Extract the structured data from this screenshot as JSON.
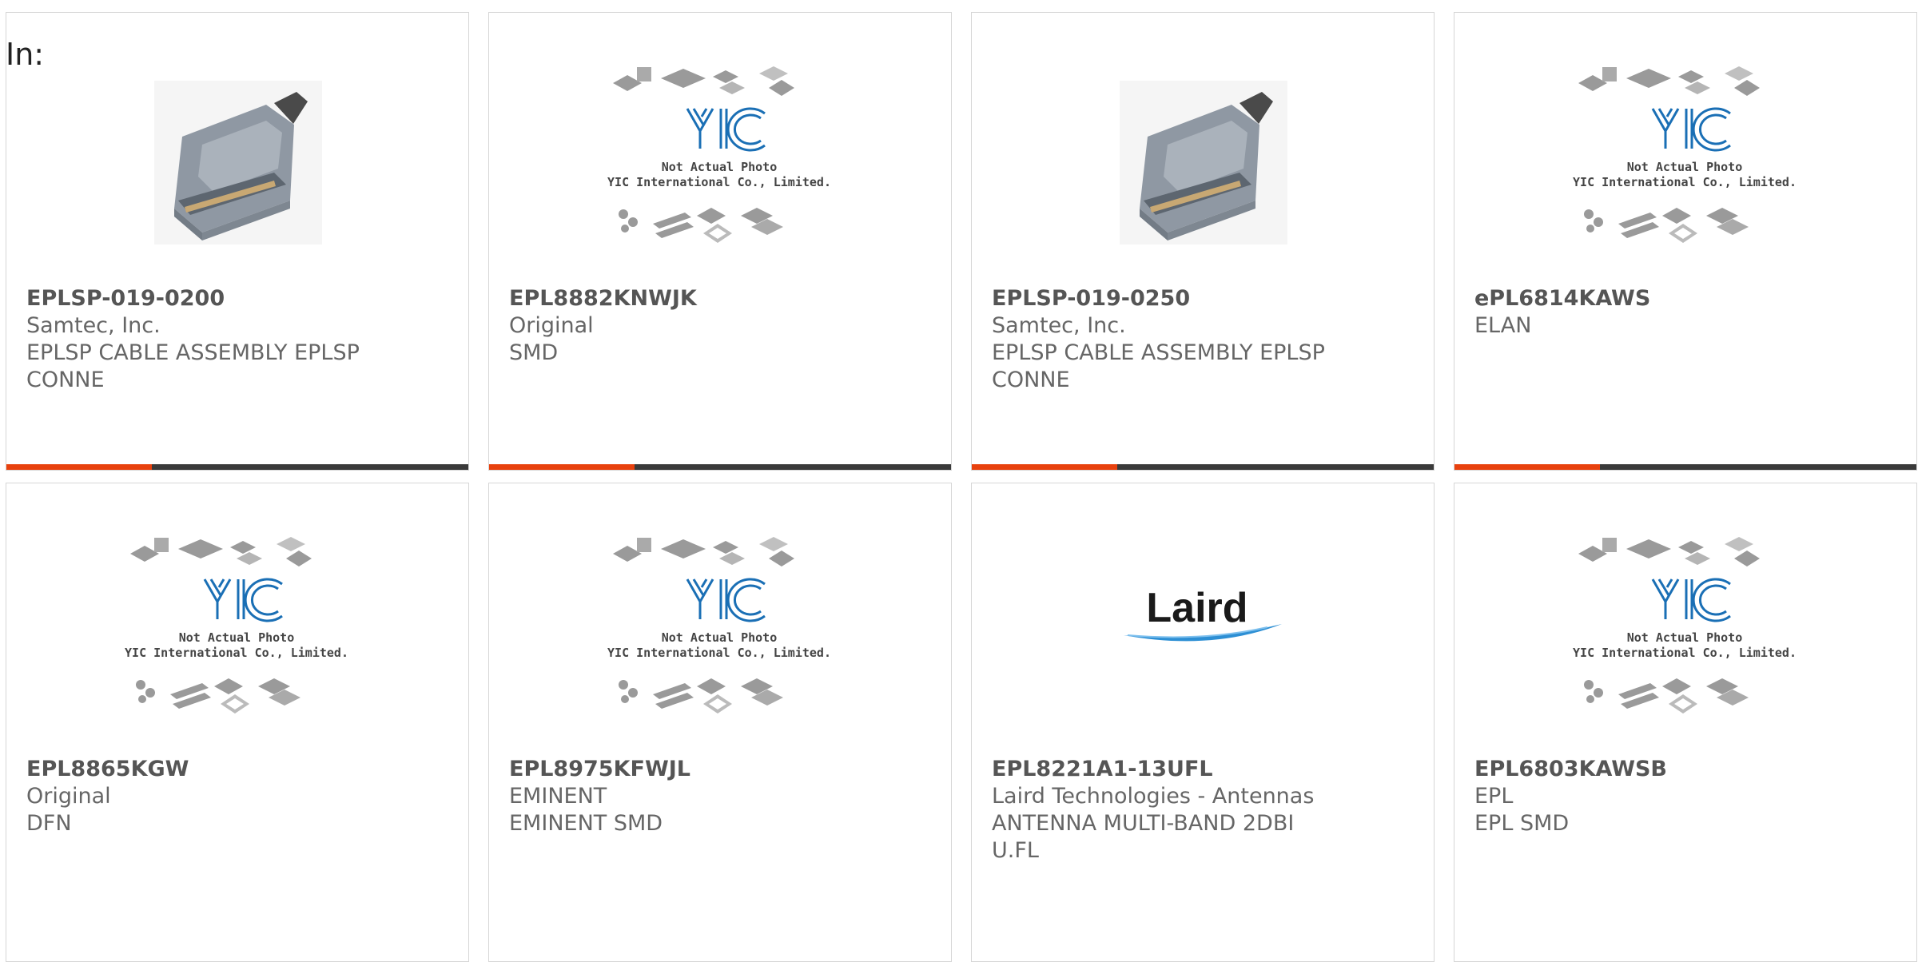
{
  "in_label": "In:",
  "products": [
    {
      "name": "EPLSP-019-0200",
      "lines": [
        "Samtec, Inc.",
        "EPLSP CABLE ASSEMBLY EPLSP",
        "CONNE"
      ],
      "image": "connector"
    },
    {
      "name": "EPL8882KNWJK",
      "lines": [
        "Original",
        "SMD"
      ],
      "image": "yic"
    },
    {
      "name": "EPLSP-019-0250",
      "lines": [
        "Samtec, Inc.",
        "EPLSP CABLE ASSEMBLY EPLSP",
        "CONNE"
      ],
      "image": "connector"
    },
    {
      "name": "ePL6814KAWS",
      "lines": [
        "ELAN"
      ],
      "image": "yic"
    },
    {
      "name": "EPL8865KGW",
      "lines": [
        "Original",
        "DFN"
      ],
      "image": "yic"
    },
    {
      "name": "EPL8975KFWJL",
      "lines": [
        "EMINENT",
        "EMINENT SMD"
      ],
      "image": "yic"
    },
    {
      "name": "EPL8221A1-13UFL",
      "lines": [
        "Laird Technologies - Antennas",
        "ANTENNA MULTI-BAND 2DBI",
        "U.FL"
      ],
      "image": "laird"
    },
    {
      "name": "EPL6803KAWSB",
      "lines": [
        "EPL",
        "EPL SMD"
      ],
      "image": "yic"
    }
  ],
  "yic_text": {
    "line1": "Not Actual Photo",
    "line2": "YIC International Co., Limited."
  },
  "laird_text": "Laird",
  "colors": {
    "accent": "#e8410e",
    "bar": "#3a3a3a",
    "yic_blue": "#1a6fb5"
  }
}
